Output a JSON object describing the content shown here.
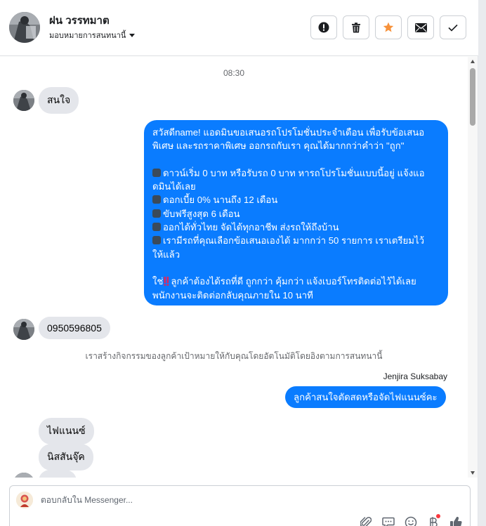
{
  "header": {
    "contact_name": "ฝน วรรทมาต",
    "assign_label": "มอบหมายการสนทนานี้",
    "actions": [
      {
        "icon": "alert-icon",
        "label": "Mark as spam"
      },
      {
        "icon": "trash-icon",
        "label": "Delete"
      },
      {
        "icon": "star-icon",
        "label": "Star"
      },
      {
        "icon": "envelope-icon",
        "label": "Mark as unread"
      },
      {
        "icon": "check-icon",
        "label": "Mark as done"
      }
    ]
  },
  "thread": {
    "timestamp": "08:30",
    "msg1": "สนใจ",
    "offer": {
      "intro": [
        "สวัสดีname! แอดมินขอเสนอรถโปรโมชั่นประจำเดือน เพื่อรับข้อเสนอ",
        "พิเศษ และรถราคาพิเศษ ออกรถกับเรา คุณได้มากกว่าคำว่า \"ถูก\""
      ],
      "bullets": [
        [
          "ดาวน์เริ่ม 0 บาท หรือรับรถ 0 บาท หารถโปรโมชั่นแบบนี้อยู่ แจ้งแอ",
          "ดมินได้เลย"
        ],
        [
          "ดอกเบี้ย 0% นานถึง 12 เดือน"
        ],
        [
          "ขับฟรีสูงสุด 6 เดือน"
        ],
        [
          "ออกได้ทั่วไทย จัดได้ทุกอาชีพ ส่งรถให้ถึงบ้าน"
        ],
        [
          "เรามีรถที่คุณเลือกข้อเสนอเองได้ มากกว่า 50 รายการ เราเตรียมไว้",
          "ให้แล้ว"
        ]
      ],
      "closing_prefix": "ใช่",
      "closing_rest": "ลูกค้าต้องได้รถที่ดี ถูกกว่า คุ้มกว่า แจ้งเบอร์โทรติดต่อไว้ได้เลย",
      "closing_line2": "พนักงานจะติดต่อกลับคุณภายใน 10 นาที"
    },
    "msg_phone": "0950596805",
    "system_note": "เราสร้างกิจกรรมของลูกค้าเป้าหมายให้กับคุณโดยอัตโนมัติโดยอิงตามการสนทนานี้",
    "agent_name": "Jenjira Suksabay",
    "agent_reply": "ลูกค้าสนใจตัดสดหรือจัดไฟแนนซ์คะ",
    "msg_finance": "ไฟแนนซ์",
    "msg_nissan": "นิสสันจุ๊ค"
  },
  "composer": {
    "placeholder": "ตอบกลับใน Messenger...",
    "tools": [
      "paperclip-icon",
      "chat-bubble-icon",
      "smiley-icon",
      "baht-icon",
      "thumbs-up-icon"
    ]
  },
  "colors": {
    "outgoing_bubble": "#0a7cff",
    "incoming_bubble": "#e4e6eb",
    "star": "#f7923b"
  }
}
